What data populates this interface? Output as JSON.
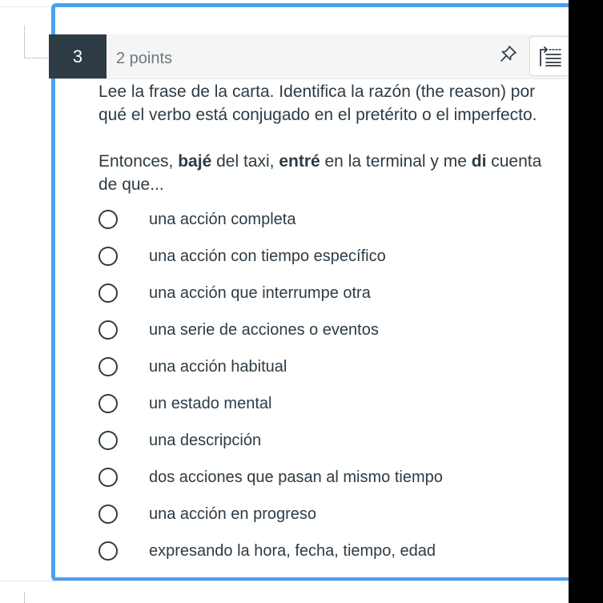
{
  "question": {
    "number": "3",
    "points": "2 points",
    "prompt_line1": "Lee la frase de la carta.  Identifica la razón (the reason) por",
    "prompt_line2": "qué el verbo está conjugado en el pretérito o el imperfecto.",
    "sentence": {
      "part1": "Entonces, ",
      "verb1": "bajé",
      "part2": " del taxi, ",
      "verb2": "entré",
      "part3": " en la terminal y me ",
      "verb3": "di",
      "part4": " cuenta",
      "line2": "de que..."
    },
    "answers": [
      "una acción completa",
      "una acción con tiempo específico",
      "una acción que interrumpe otra",
      "una serie de acciones o eventos",
      "una acción habitual",
      "un estado mental",
      "una descripción",
      "dos acciones que pasan al mismo tiempo",
      "una acción en progreso",
      "expresando la hora, fecha, tiempo, edad"
    ]
  },
  "icons": {
    "pin": "pin-icon",
    "question-list": "question-list-icon"
  },
  "colors": {
    "card_border": "#4c9ff2",
    "number_badge": "#2d3b45",
    "text": "#2d3b45",
    "points_text": "#6b7780"
  }
}
